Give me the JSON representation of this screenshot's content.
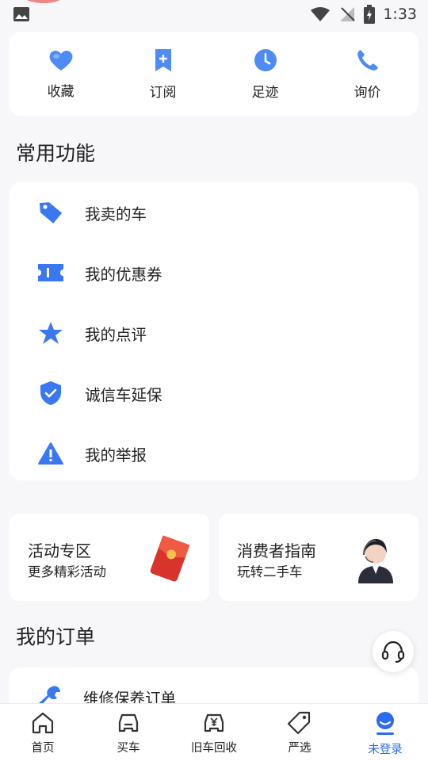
{
  "status_bar": {
    "time": "1:33",
    "photo_icon": "image-icon",
    "wifi_icon": "wifi-icon",
    "signal_icon": "no-signal-icon",
    "battery_icon": "battery-charging-icon"
  },
  "quick": [
    {
      "label": "收藏",
      "icon": "heart-icon"
    },
    {
      "label": "订阅",
      "icon": "bookmark-plus-icon"
    },
    {
      "label": "足迹",
      "icon": "clock-icon"
    },
    {
      "label": "询价",
      "icon": "phone-icon"
    }
  ],
  "common": {
    "title": "常用功能",
    "items": [
      {
        "label": "我卖的车",
        "icon": "tag-icon"
      },
      {
        "label": "我的优惠券",
        "icon": "ticket-icon"
      },
      {
        "label": "我的点评",
        "icon": "star-icon"
      },
      {
        "label": "诚信车延保",
        "icon": "shield-check-icon"
      },
      {
        "label": "我的举报",
        "icon": "warning-icon"
      }
    ]
  },
  "promos": [
    {
      "title": "活动专区",
      "sub": "更多精彩活动",
      "icon": "red-envelope-icon"
    },
    {
      "title": "消费者指南",
      "sub": "玩转二手车",
      "icon": "customer-service-avatar"
    }
  ],
  "orders": {
    "title": "我的订单",
    "items": [
      {
        "label": "维修保养订单",
        "icon": "wrench-icon"
      }
    ]
  },
  "nav": [
    {
      "label": "首页",
      "icon": "home-icon",
      "active": false
    },
    {
      "label": "买车",
      "icon": "car-icon",
      "active": false
    },
    {
      "label": "旧车回收",
      "icon": "car-recycle-icon",
      "active": false
    },
    {
      "label": "严选",
      "icon": "tag-outline-icon",
      "active": false
    },
    {
      "label": "未登录",
      "icon": "user-icon",
      "active": true
    }
  ],
  "colors": {
    "accent": "#2a6bf0",
    "background": "#f7f7fa",
    "card": "#ffffff"
  }
}
